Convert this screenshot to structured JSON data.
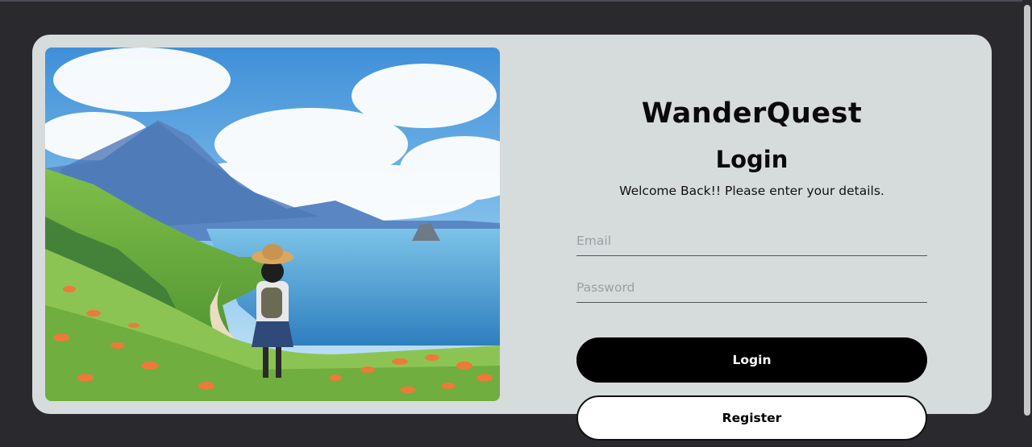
{
  "app": {
    "brand": "WanderQuest",
    "heading": "Login",
    "subtitle": "Welcome Back!! Please enter your details."
  },
  "form": {
    "email_placeholder": "Email",
    "email_value": "",
    "password_placeholder": "Password",
    "password_value": "",
    "login_label": "Login",
    "register_label": "Register"
  },
  "colors": {
    "page_bg": "#2a2a2e",
    "card_bg": "#d6dbdb",
    "primary_button": "#000000",
    "secondary_button": "#ffffff"
  },
  "hero_image": {
    "icon": "landscape-illustration"
  }
}
